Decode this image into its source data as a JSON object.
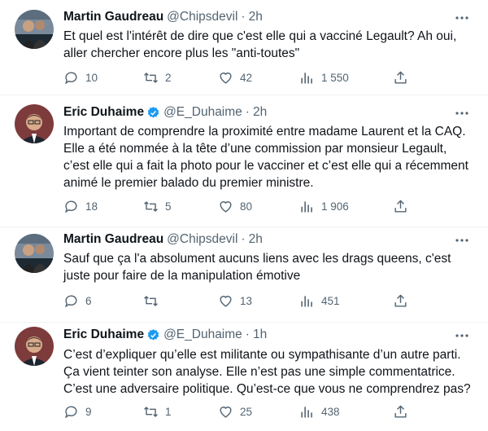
{
  "tweets": [
    {
      "name": "Martin Gaudreau",
      "handle": "@Chipsdevil",
      "time": "2h",
      "verified": false,
      "lines": [
        "Et quel est l'intérêt de dire que c'est elle qui a vacciné Legault? Ah oui,",
        "aller chercher encore plus les \"anti-toutes\""
      ],
      "replies": "10",
      "retweets": "2",
      "likes": "42",
      "views": "1 550"
    },
    {
      "name": "Eric Duhaime",
      "handle": "@E_Duhaime",
      "time": "2h",
      "verified": true,
      "lines": [
        "Important de comprendre la proximité entre madame Laurent et la CAQ.",
        "Elle a été nommée à la tête d’une commission par monsieur Legault,",
        "c’est elle qui a fait la photo pour le vacciner et c’est elle qui a récemment",
        "animé le premier balado du premier ministre."
      ],
      "replies": "18",
      "retweets": "5",
      "likes": "80",
      "views": "1 906"
    },
    {
      "name": "Martin Gaudreau",
      "handle": "@Chipsdevil",
      "time": "2h",
      "verified": false,
      "lines": [
        "Sauf que ça l'a absolument aucuns liens avec les drags queens, c'est",
        "juste pour faire de la manipulation émotive"
      ],
      "replies": "6",
      "retweets": "",
      "likes": "13",
      "views": "451"
    },
    {
      "name": "Eric Duhaime",
      "handle": "@E_Duhaime",
      "time": "1h",
      "verified": true,
      "lines": [
        "C’est d’expliquer qu’elle est militante ou sympathisante d’un autre parti.",
        "Ça vient teinter son analyse. Elle n’est pas une simple commentatrice.",
        "C’est une adversaire politique. Qu’est-ce que vous ne comprendrez pas?"
      ],
      "replies": "9",
      "retweets": "1",
      "likes": "25",
      "views": "438"
    }
  ],
  "colors": {
    "text": "#0f1419",
    "secondary": "#536471",
    "verified": "#1d9bf0"
  },
  "icons": {
    "reply": "reply-icon",
    "retweet": "retweet-icon",
    "like": "heart-icon",
    "views": "views-icon",
    "share": "share-icon",
    "more": "more-icon"
  }
}
